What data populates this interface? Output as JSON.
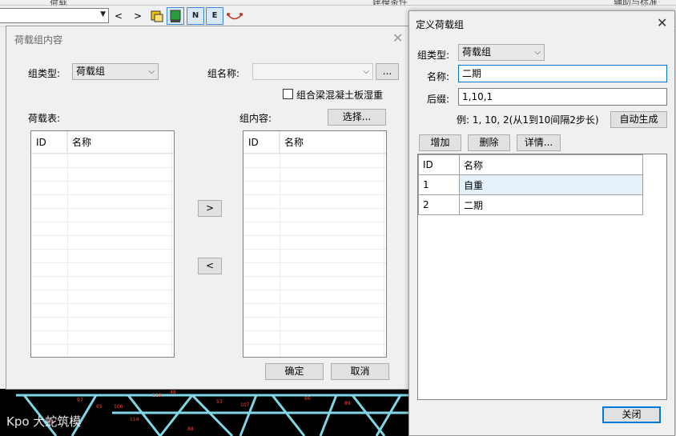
{
  "toolbar": {
    "cut_labels": [
      "荷载",
      "建模条件",
      "辅助与标准"
    ],
    "nav_prev": "<",
    "nav_next": ">",
    "icon_n": "N",
    "icon_e": "E"
  },
  "model_watermark": "Kpo 大蛇筑模",
  "dialog_group_content": {
    "title": "荷载组内容",
    "group_type_label": "组类型:",
    "group_type_value": "荷载组",
    "group_name_label": "组名称:",
    "group_name_value": "",
    "browse_button": "...",
    "checkbox_label": "组合梁混凝土板湿重",
    "load_table_label": "荷载表:",
    "group_content_label": "组内容:",
    "select_button": "选择...",
    "col_id": "ID",
    "col_name": "名称",
    "move_right": ">",
    "move_left": "<",
    "ok_button": "确定",
    "cancel_button": "取消"
  },
  "dialog_define_group": {
    "title": "定义荷载组",
    "group_type_label": "组类型:",
    "group_type_value": "荷载组",
    "name_label": "名称:",
    "name_value": "二期",
    "suffix_label": "后缀:",
    "suffix_value": "1,10,1",
    "example_text": "例: 1, 10, 2(从1到10间隔2步长)",
    "auto_generate_button": "自动生成",
    "add_button": "增加",
    "delete_button": "删除",
    "detail_button": "详情...",
    "col_id": "ID",
    "col_name": "名称",
    "rows": [
      {
        "id": "1",
        "name": "自重"
      },
      {
        "id": "2",
        "name": "二期"
      }
    ],
    "close_button": "关闭"
  }
}
